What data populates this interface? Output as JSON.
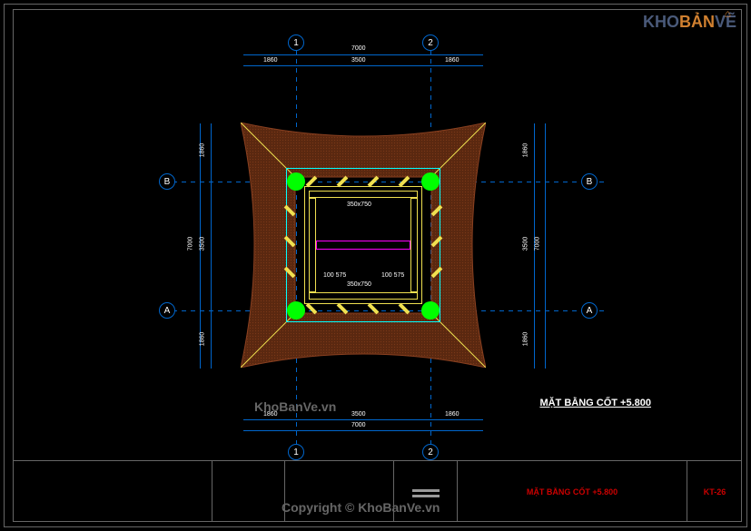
{
  "logo": {
    "kho": "KHO",
    "ban": "BẢN",
    "ve": "VẼ"
  },
  "watermark": "KhoBanVe.vn",
  "copyright": "Copyright © KhoBanVe.vn",
  "drawing_title": "MẶT BẰNG CỐT +5.800",
  "grid": {
    "col1": "1",
    "col2": "2",
    "rowA": "A",
    "rowB": "B"
  },
  "dimensions": {
    "top_total": "7000",
    "top_seg1": "1860",
    "top_seg2": "3500",
    "top_seg3": "1860",
    "left_total": "7000",
    "left_seg1": "1860",
    "left_seg2": "3500",
    "left_seg3": "1860",
    "inner_beam": "350x750",
    "inner_span": "100 575",
    "mid_span": "3500"
  },
  "title_block": {
    "sheet_title": "MẶT BẰNG CỐT +5.800",
    "sheet_no": "KT-26"
  }
}
